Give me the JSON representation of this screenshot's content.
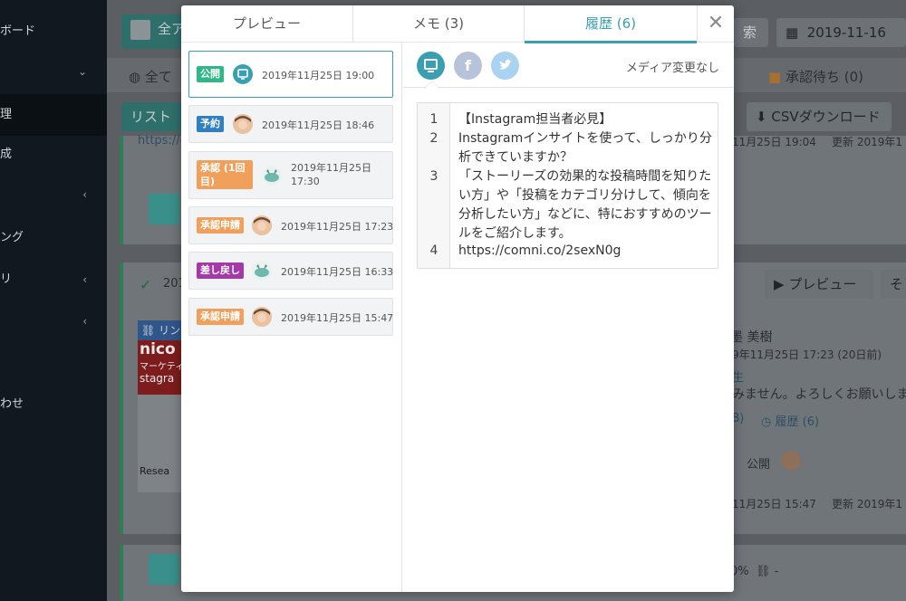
{
  "background": {
    "sidebar_items": [
      "ボード",
      "",
      "理",
      "成",
      "",
      "ング",
      "リ",
      "",
      "わせ"
    ],
    "buttons": {
      "all_btn": "全ア",
      "search_btn": "索",
      "date": "2019-11-16",
      "all2": "全て",
      "approval_wait": "承認待ち (0)",
      "list_btn": "リスト",
      "csv_btn": "CSVダウンロード",
      "preview_btn": "プレビュー",
      "preview_btn2": "そ"
    },
    "texts": {
      "url_fragment": "https://c",
      "date_frag1": "11月25日 19:04",
      "date_frag2": "更新 2019年1",
      "year_frag": "201",
      "link_label": "リン",
      "banner_brand": "nico",
      "banner_sub": "マーケティ",
      "banner_sub2": "stagra",
      "research": "Resea",
      "user_name": "墨 美樹",
      "user_date": "9年11月25日 17:23 (20日前)",
      "user_role": "生",
      "user_msg": "みません。よろしくお願いします",
      "memo_count": "8)",
      "history_link": "履歴 (6)",
      "public_label": "公開",
      "date_frag3": "11月25日 15:47",
      "date_frag4": "更新 2019年1",
      "percent": "0%",
      "dash": "-"
    }
  },
  "modal": {
    "tabs": [
      {
        "label": "プレビュー"
      },
      {
        "label": "メモ (3)"
      },
      {
        "label": "履歴 (6)"
      }
    ],
    "close_glyph": "✕",
    "history": [
      {
        "badge": "公開",
        "badge_color": "#2eb886",
        "icon": "instagram-icon",
        "date": "2019年11月25日 19:00"
      },
      {
        "badge": "予約",
        "badge_color": "#2f7fc1",
        "icon": "user-avatar-icon",
        "date": "2019年11月25日 18:46"
      },
      {
        "badge": "承認 (1回目)",
        "badge_color": "#f0a05a",
        "icon": "whale-avatar-icon",
        "date": "2019年11月25日 17:30"
      },
      {
        "badge": "承認申請",
        "badge_color": "#f0a05a",
        "icon": "user-avatar-icon",
        "date": "2019年11月25日 17:23"
      },
      {
        "badge": "差し戻し",
        "badge_color": "#a43aa8",
        "icon": "whale-avatar-icon",
        "date": "2019年11月25日 16:33"
      },
      {
        "badge": "承認申請",
        "badge_color": "#f0a05a",
        "icon": "user-avatar-icon",
        "date": "2019年11月25日 15:47"
      }
    ],
    "sns": {
      "instagram_color": "#3a9fb0",
      "facebook_color": "#b6c3d9",
      "twitter_color": "#a9d3f0"
    },
    "media_note": "メディア変更なし",
    "content_lines": [
      {
        "num": "1",
        "text": "【Instagram担当者必見】"
      },
      {
        "num": "2",
        "text": "Instagramインサイトを使って、しっかり分析できていますか？"
      },
      {
        "num": "3",
        "text": "「ストーリーズの効果的な投稿時間を知りたい方」や「投稿をカテゴリ分けして、傾向を分析したい方」などに、特におすすめのツールをご紹介します。"
      },
      {
        "num": "4",
        "text": "https://comni.co/2sexN0g"
      }
    ]
  }
}
